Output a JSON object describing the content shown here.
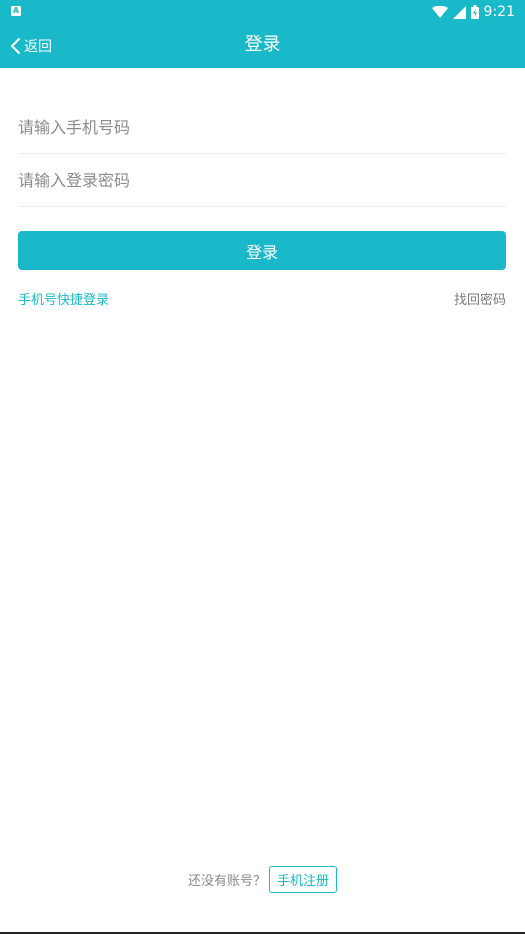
{
  "status_bar": {
    "notification_icon": "a-notification-icon",
    "time": "9:21",
    "icons": [
      "wifi-icon",
      "signal-icon",
      "battery-icon"
    ]
  },
  "nav": {
    "back_label": "返回",
    "title": "登录"
  },
  "form": {
    "phone_placeholder": "请输入手机号码",
    "password_placeholder": "请输入登录密码",
    "login_label": "登录"
  },
  "links": {
    "quick_login": "手机号快捷登录",
    "forgot_password": "找回密码"
  },
  "footer": {
    "no_account": "还没有账号？",
    "register_label": "手机注册"
  },
  "colors": {
    "accent": "#1ab9c9",
    "muted_text": "#8a8a8a",
    "background": "#ffffff"
  }
}
